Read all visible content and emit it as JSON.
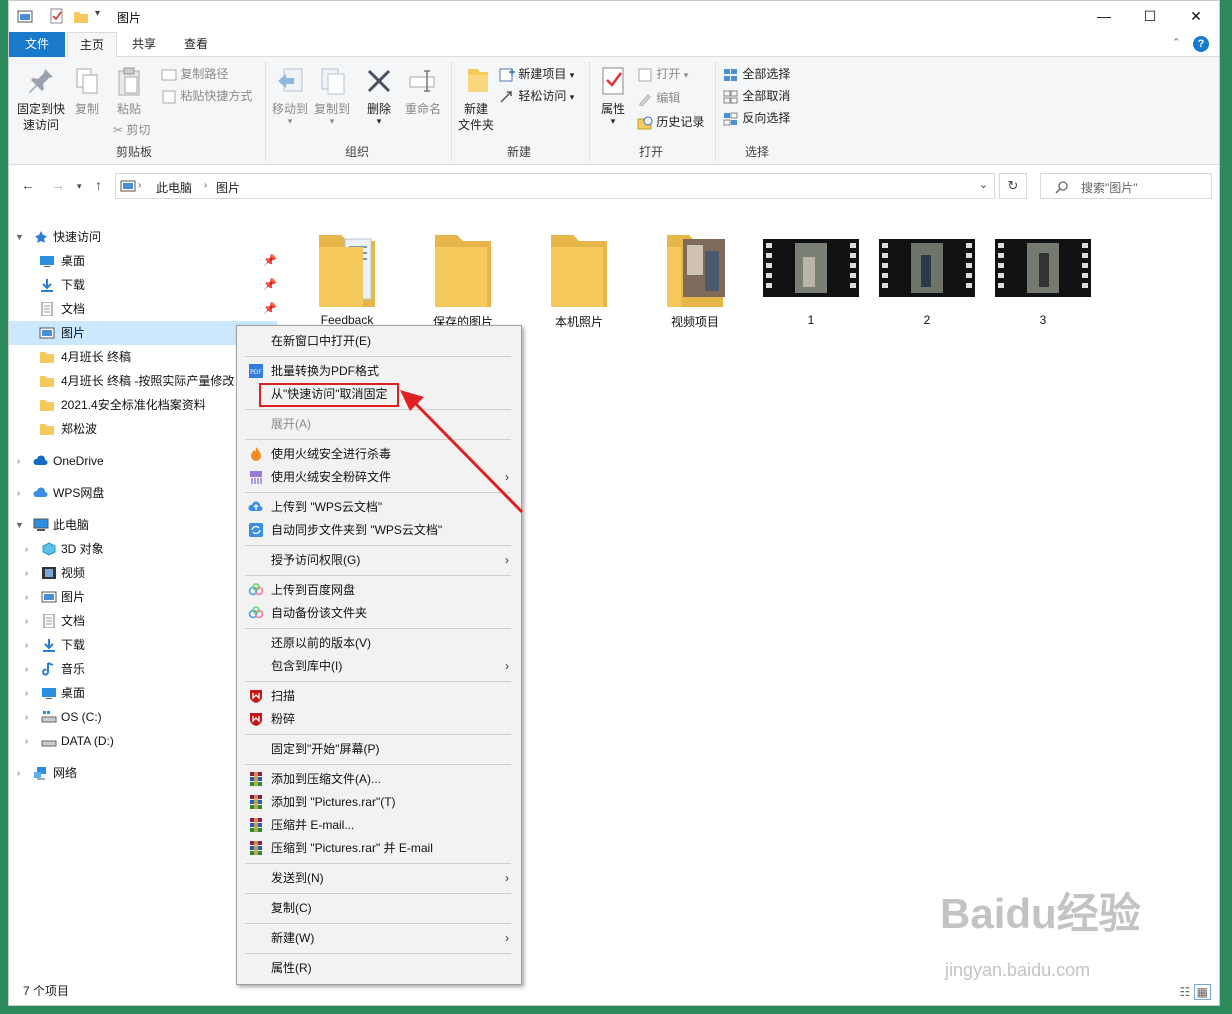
{
  "window": {
    "title": "图片"
  },
  "tabs": [
    {
      "label": "文件"
    },
    {
      "label": "主页"
    },
    {
      "label": "共享"
    },
    {
      "label": "查看"
    }
  ],
  "ribbon": {
    "clipboard": {
      "pin": "固定到快\n速访问",
      "copy": "复制",
      "paste": "粘贴",
      "copy_path": "复制路径",
      "paste_shortcut": "粘贴快捷方式",
      "cut": "剪切",
      "label": "剪贴板"
    },
    "organize": {
      "move_to": "移动到",
      "copy_to": "复制到",
      "delete": "删除",
      "rename": "重命名",
      "label": "组织"
    },
    "new": {
      "new_folder": "新建\n文件夹",
      "new_item": "新建项目",
      "easy_access": "轻松访问",
      "label": "新建"
    },
    "open": {
      "properties": "属性",
      "open": "打开",
      "edit": "编辑",
      "history": "历史记录",
      "label": "打开"
    },
    "select": {
      "select_all": "全部选择",
      "select_none": "全部取消",
      "invert": "反向选择",
      "label": "选择"
    }
  },
  "address": {
    "crumbs": [
      "此电脑",
      "图片"
    ],
    "search_placeholder": "搜索\"图片\""
  },
  "nav": {
    "quick_access": "快速访问",
    "pinned": [
      "桌面",
      "下载",
      "文档",
      "图片"
    ],
    "recent": [
      "4月班长  终稿",
      "4月班长  终稿 -按照实际产量修改",
      "2021.4安全标准化档案资料",
      "郑松波"
    ],
    "onedrive": "OneDrive",
    "wps": "WPS网盘",
    "this_pc": "此电脑",
    "pc_items": [
      "3D 对象",
      "视频",
      "图片",
      "文档",
      "下载",
      "音乐",
      "桌面",
      "OS (C:)",
      "DATA (D:)"
    ],
    "network": "网络"
  },
  "files": [
    {
      "name": "Feedback",
      "type": "folder"
    },
    {
      "name": "保存的图片",
      "type": "folder"
    },
    {
      "name": "本机照片",
      "type": "folder"
    },
    {
      "name": "视频项目",
      "type": "folder-photo"
    },
    {
      "name": "1",
      "type": "video"
    },
    {
      "name": "2",
      "type": "video"
    },
    {
      "name": "3",
      "type": "video"
    }
  ],
  "status": {
    "count": "7 个项目"
  },
  "context_menu": {
    "items": [
      "在新窗口中打开(E)",
      "批量转换为PDF格式",
      "从\"快速访问\"取消固定",
      "展开(A)",
      "使用火绒安全进行杀毒",
      "使用火绒安全粉碎文件",
      "上传到 \"WPS云文档\"",
      "自动同步文件夹到 \"WPS云文档\"",
      "授予访问权限(G)",
      "上传到百度网盘",
      "自动备份该文件夹",
      "还原以前的版本(V)",
      "包含到库中(I)",
      "扫描",
      "粉碎",
      "固定到\"开始\"屏幕(P)",
      "添加到压缩文件(A)...",
      "添加到 \"Pictures.rar\"(T)",
      "压缩并 E-mail...",
      "压缩到 \"Pictures.rar\" 并 E-mail",
      "发送到(N)",
      "复制(C)",
      "新建(W)",
      "属性(R)"
    ]
  },
  "watermark": {
    "brand": "Baidu经验",
    "url": "jingyan.baidu.com"
  },
  "colors": {
    "accent": "#1979ca",
    "selected": "#cce8ff",
    "folder": "#f5c95c",
    "highlight": "#e02020",
    "background": "#2d8a5d"
  }
}
